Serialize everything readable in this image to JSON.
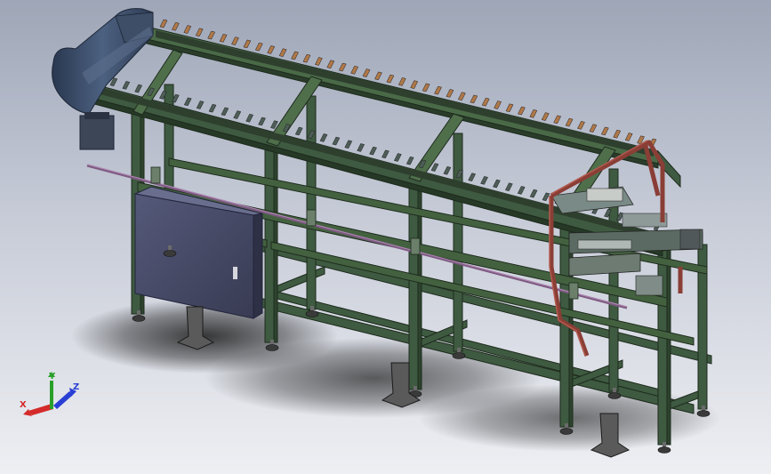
{
  "viewport": {
    "background_top": "#9ea6b7",
    "background_bottom": "#eeeff3"
  },
  "colors": {
    "frame": "#3e5a40",
    "frame_dark": "#243524",
    "frame_light": "#5d7c5b",
    "cleat": "#b07848",
    "motor": "#3d4e66",
    "cabinet": "#4b4f6a",
    "guide": "#8a3e36",
    "rod": "#7e5a82",
    "x_axis": "#d42a2a",
    "y_axis": "#2aa02a",
    "z_axis": "#2a3fd4"
  },
  "triad": {
    "x_label": "X",
    "y_label": "Y",
    "z_label": "Z"
  },
  "model": {
    "icons": {
      "cabinet": "electrical-cabinet-icon",
      "motor": "drive-motor-icon",
      "feet": "leveling-foot-icon"
    }
  }
}
